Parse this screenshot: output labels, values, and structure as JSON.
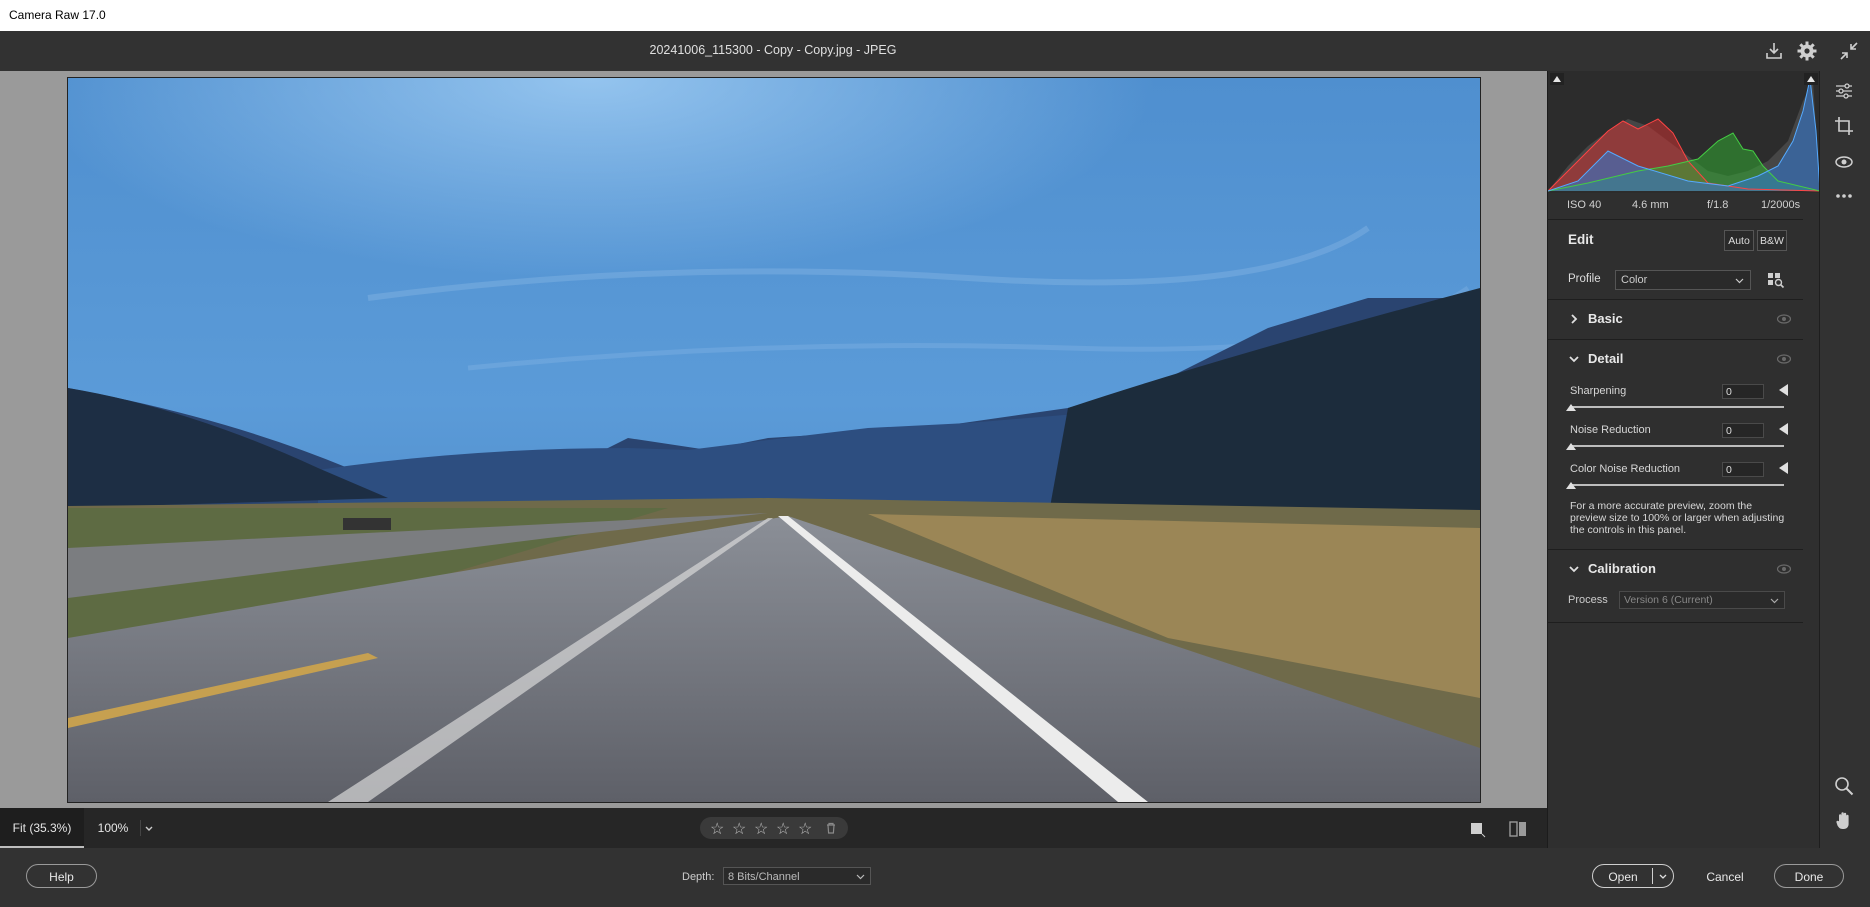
{
  "window": {
    "title": "Camera Raw 17.0"
  },
  "header": {
    "filename": "20241006_115300 - Copy - Copy.jpg  -  JPEG"
  },
  "exif": {
    "iso": "ISO 40",
    "focal": "4.6 mm",
    "aperture": "f/1.8",
    "shutter": "1/2000s"
  },
  "edit": {
    "title": "Edit",
    "auto_label": "Auto",
    "bw_label": "B&W",
    "profile_label": "Profile",
    "profile_value": "Color"
  },
  "sections": {
    "basic": "Basic",
    "detail": "Detail",
    "calibration": "Calibration"
  },
  "detail": {
    "sliders": [
      {
        "label": "Sharpening",
        "value": "0"
      },
      {
        "label": "Noise Reduction",
        "value": "0"
      },
      {
        "label": "Color Noise Reduction",
        "value": "0"
      }
    ],
    "note": "For a more accurate preview, zoom the preview size to 100% or larger when adjusting the controls in this panel."
  },
  "calibration": {
    "process_label": "Process",
    "process_value": "Version 6 (Current)"
  },
  "view": {
    "fit_label": "Fit (35.3%)",
    "zoom_label": "100%"
  },
  "rating": {
    "stars": 0
  },
  "footer": {
    "help_label": "Help",
    "depth_label": "Depth:",
    "depth_value": "8 Bits/Channel",
    "open_label": "Open",
    "cancel_label": "Cancel",
    "done_label": "Done"
  },
  "colors": {
    "panel_bg": "#2f2f2f",
    "canvas_bg": "#9a9a9a",
    "accent": "#e0e0e0"
  }
}
